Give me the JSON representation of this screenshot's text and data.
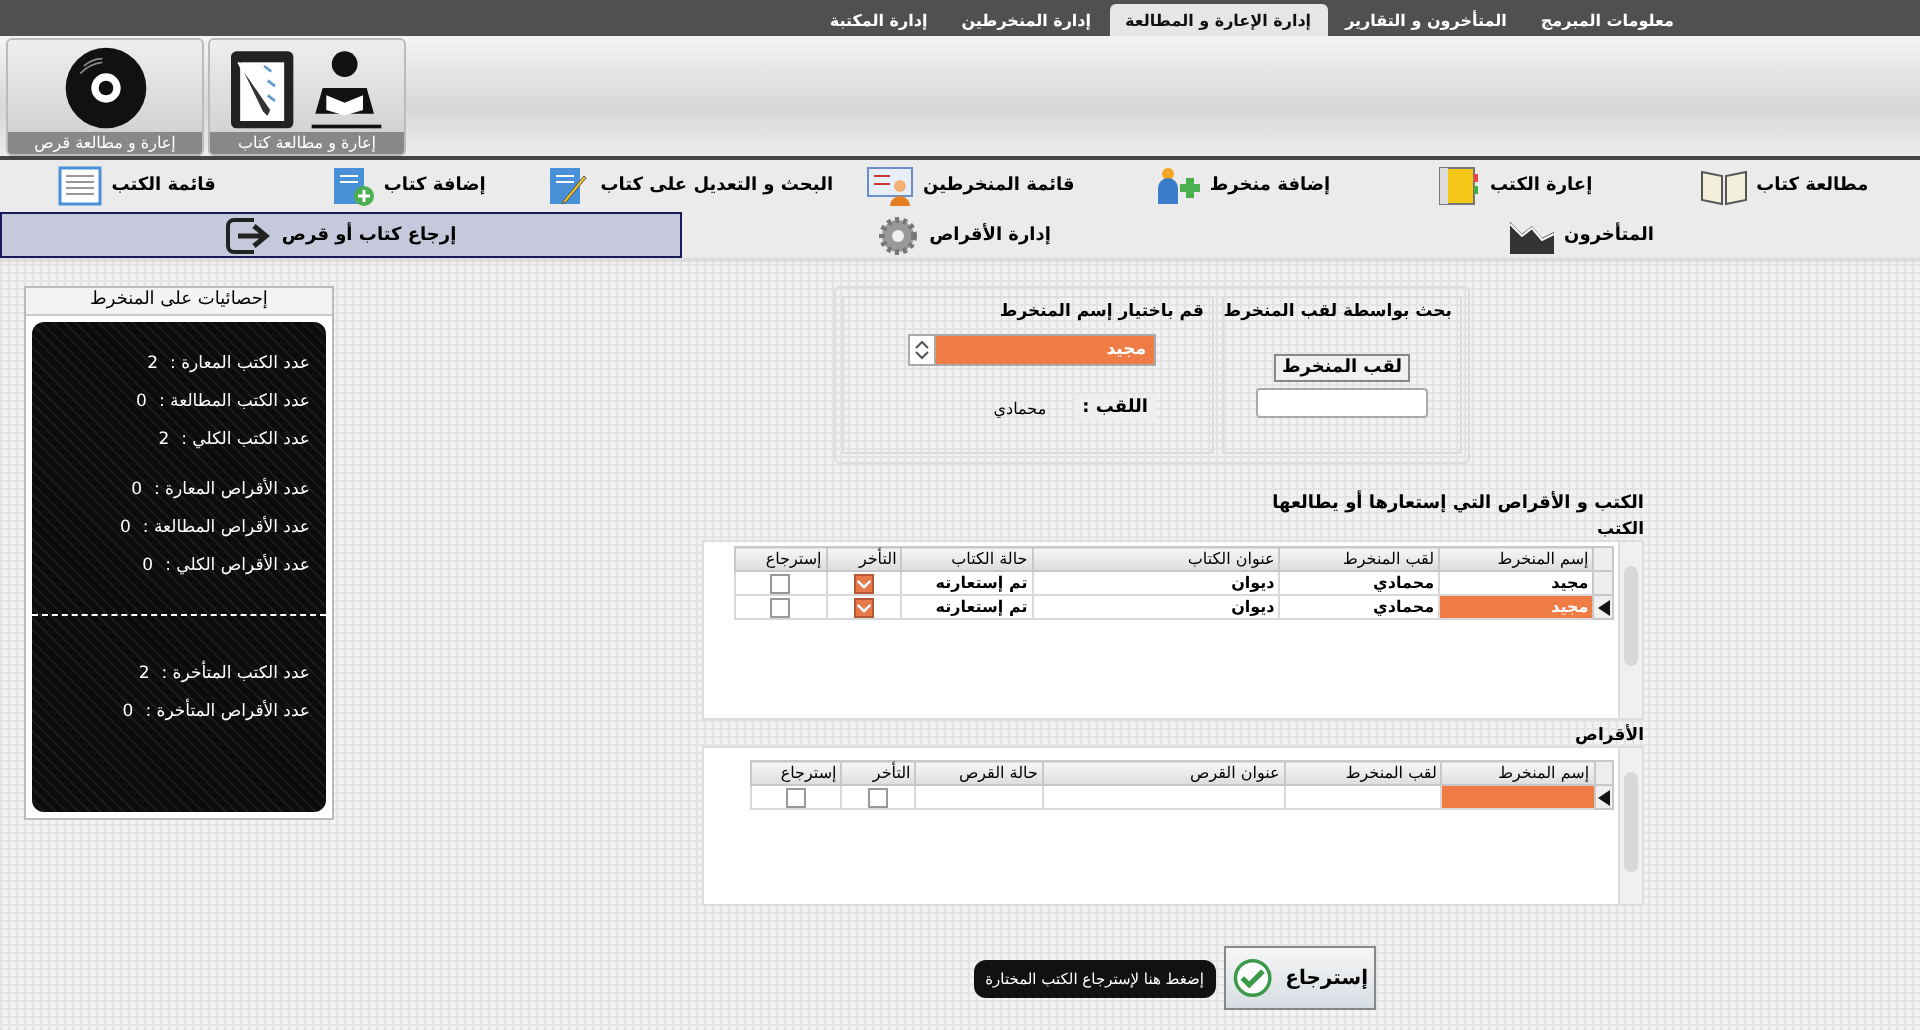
{
  "tabs": [
    {
      "label": "معلومات المبرمج",
      "selected": false
    },
    {
      "label": "المتأخرون و التقارير",
      "selected": false
    },
    {
      "label": "إدارة الإعارة و المطالعة",
      "selected": true
    },
    {
      "label": "إدارة المنخرطين",
      "selected": false
    },
    {
      "label": "إدارة المكتبة",
      "selected": false
    }
  ],
  "ribbon": [
    {
      "label": "إعارة و مطالعة كتاب",
      "kind": "book"
    },
    {
      "label": "إعارة و مطالعة قرص",
      "kind": "disc"
    }
  ],
  "nav_rows": [
    [
      {
        "label": "مطالعة كتاب",
        "selected": false
      },
      {
        "label": "إعارة الكتب",
        "selected": false
      },
      {
        "label": "إضافة منخرط",
        "selected": false
      },
      {
        "label": "قائمة المنخرطين",
        "selected": false
      },
      {
        "label": "البحث و التعديل على كتاب",
        "selected": false
      },
      {
        "label": "إضافة كتاب",
        "selected": false
      },
      {
        "label": "قائمة الكتب",
        "selected": false
      }
    ],
    [
      {
        "label": "المتأخرون",
        "selected": false
      },
      {
        "label": "إدارة الأقراص",
        "selected": false
      },
      {
        "label": "إرجاع كتاب أو قرص",
        "selected": true
      }
    ]
  ],
  "stats": {
    "title": "إحصائيات على المنخرط",
    "groups": [
      [
        {
          "label": "عدد الكتب المعارة :",
          "value": "2"
        },
        {
          "label": "عدد الكتب المطالعة :",
          "value": "0"
        },
        {
          "label": "عدد الكتب الكلي :",
          "value": "2"
        }
      ],
      [
        {
          "label": "عدد الأقراص المعارة :",
          "value": "0"
        },
        {
          "label": "عدد الأقراص المطالعة :",
          "value": "0"
        },
        {
          "label": "عدد الأقراص الكلي :",
          "value": "0"
        }
      ],
      [
        {
          "label": "عدد الكتب المتأخرة :",
          "value": "2"
        },
        {
          "label": "عدد الأقراص المتأخرة :",
          "value": "0"
        }
      ]
    ]
  },
  "search": {
    "title": "بحث بواسطة لقب المنخرط",
    "button": "لقب المنخرط"
  },
  "choose": {
    "title": "قم باختيار إسم المنخرط",
    "value": "مجيد",
    "surname_label": "اللقب :",
    "surname_value": "محمادي"
  },
  "loans": {
    "title": "الكتب و الأقراص التي إستعارها أو يطالعها",
    "grids": [
      {
        "title": "الكتب",
        "columns": [
          "إسم المنخرط",
          "لقب المنخرط",
          "عنوان الكتاب",
          "حالة الكتاب",
          "التأخر",
          "إسترجاع"
        ],
        "rows": [
          {
            "cells": [
              "مجيد",
              "محمادي",
              "ديوان",
              "تم إستعارته"
            ],
            "late": true,
            "returned": false,
            "selected": false
          },
          {
            "cells": [
              "مجيد",
              "محمادي",
              "ديوان",
              "تم إستعارته"
            ],
            "late": true,
            "returned": false,
            "selected": true
          }
        ]
      },
      {
        "title": "الأقراص",
        "columns": [
          "إسم المنخرط",
          "لقب المنخرط",
          "عنوان القرص",
          "حالة القرص",
          "التأخر",
          "إسترجاع"
        ],
        "rows": [
          {
            "cells": [],
            "late": false,
            "returned": false,
            "selected": true
          }
        ]
      }
    ]
  },
  "return_button": {
    "label": "إسترجاع"
  },
  "tooltip": "إضغط هنا لإسترجاع الكتب المختارة"
}
